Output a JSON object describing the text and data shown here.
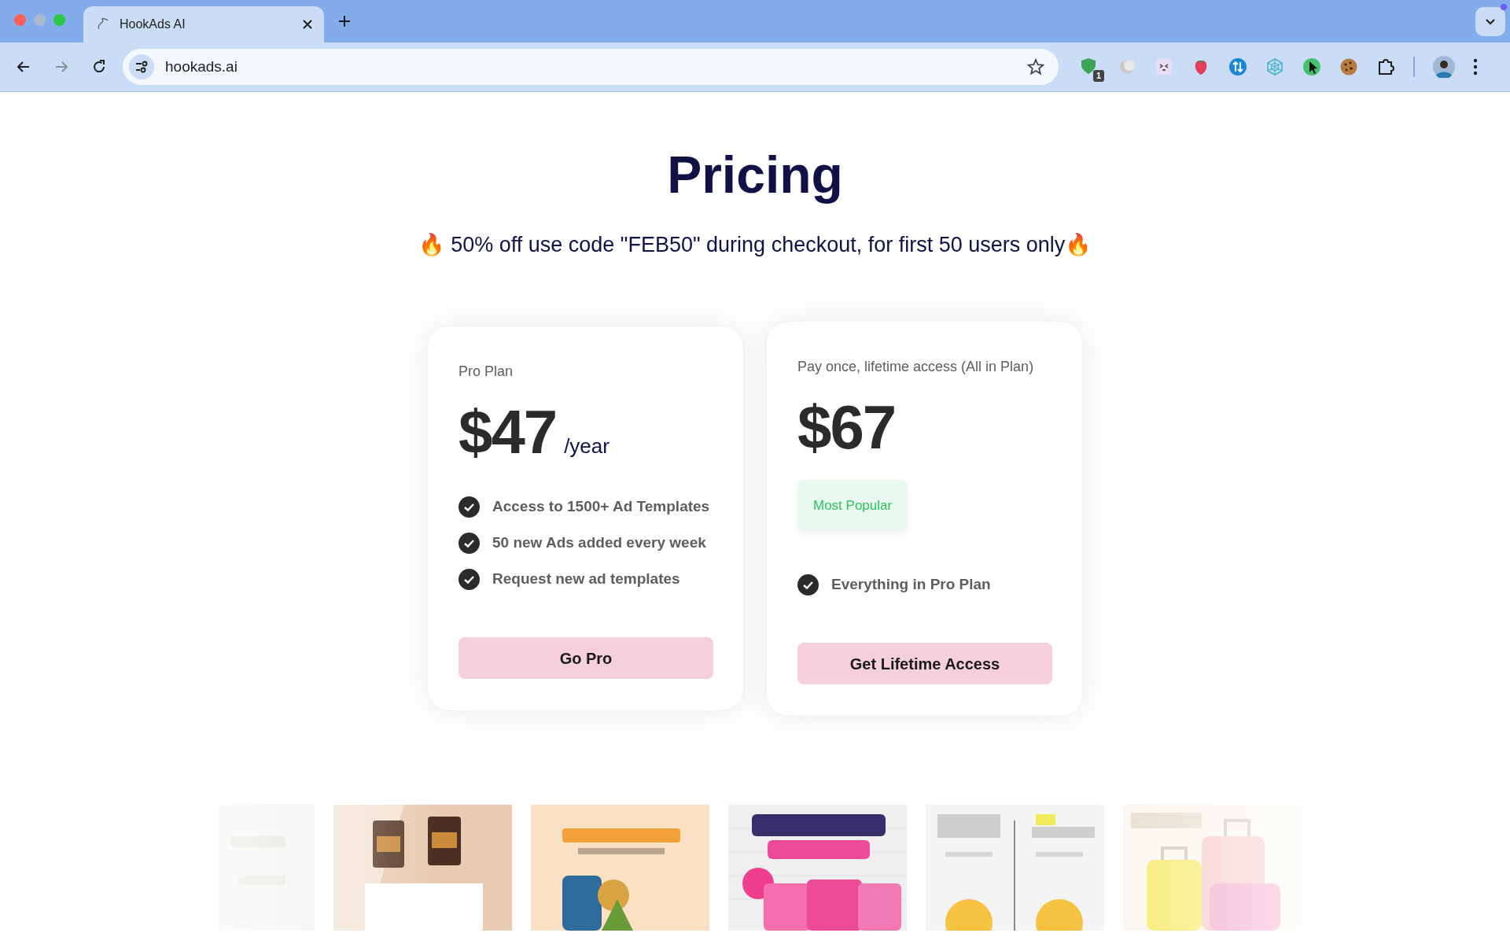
{
  "browser": {
    "tabs": [
      {
        "title": "HookAds AI",
        "selected": true
      }
    ],
    "address": "hookads.ai",
    "extension_badge": "1"
  },
  "page": {
    "title": "Pricing",
    "promo": "🔥 50% off use code \"FEB50\" during checkout, for first 50 users only🔥"
  },
  "plans": [
    {
      "name": "Pro Plan",
      "price": "$47",
      "period": "/year",
      "features": [
        "Access to 1500+ Ad Templates",
        "50 new Ads added every week",
        "Request new ad templates"
      ],
      "button": "Go Pro"
    },
    {
      "name": "Pay once, lifetime access (All in Plan)",
      "price": "$67",
      "badge": "Most Popular",
      "features": [
        "Everything in Pro Plan"
      ],
      "button": "Get Lifetime Access"
    }
  ]
}
